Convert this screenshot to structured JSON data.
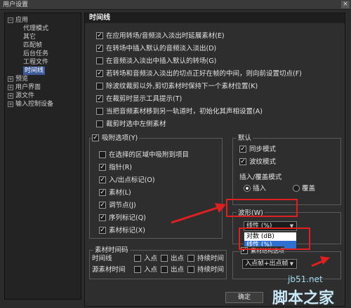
{
  "window": {
    "title": "用户设置",
    "close_glyph": "×"
  },
  "tree": {
    "items": [
      {
        "label": "应用",
        "expander": "−"
      },
      {
        "label": "代理模式"
      },
      {
        "label": "其它"
      },
      {
        "label": "匹配帧"
      },
      {
        "label": "后台任务"
      },
      {
        "label": "工程文件"
      },
      {
        "label": "时间线"
      },
      {
        "label": "预览",
        "expander": "+"
      },
      {
        "label": "用户界面",
        "expander": "+"
      },
      {
        "label": "源文件",
        "expander": "+"
      },
      {
        "label": "输入控制设备",
        "expander": "+"
      }
    ]
  },
  "panel": {
    "title": "时间线",
    "options": [
      {
        "label": "在应用转场/音频淡入淡出时延展素材(E)",
        "checked": true
      },
      {
        "label": "在转场中插入默认的音频淡入淡出(D)",
        "checked": true
      },
      {
        "label": "在音频淡入淡出中插入默认的转场(G)",
        "checked": false
      },
      {
        "label": "若转场和音频淡入淡出的切点正好在帧的中间，则向前设置切点(F)",
        "checked": true
      },
      {
        "label": "除波纹裁剪以外,剪切素材时保持下一个素材位置(K)",
        "checked": false
      },
      {
        "label": "在裁剪时显示工具提示(T)",
        "checked": true
      },
      {
        "label": "当把音频素材移到另一轨道时，初始化其声相设置(A)",
        "checked": false
      },
      {
        "label": "裁剪时选中左侧素材",
        "checked": false
      }
    ],
    "snap": {
      "title": "吸附选项(Y)",
      "checked": true,
      "items": [
        {
          "label": "在选择的区域中吸附到项目",
          "checked": false
        },
        {
          "label": "指针(R)",
          "checked": true
        },
        {
          "label": "入/出点标记(O)",
          "checked": true
        },
        {
          "label": "素材(L)",
          "checked": true
        },
        {
          "label": "调节点(J)",
          "checked": true
        },
        {
          "label": "序列标记(Q)",
          "checked": true
        },
        {
          "label": "素材标记(X)",
          "checked": true
        }
      ]
    },
    "defaults": {
      "title": "默认",
      "sync_mode": {
        "label": "同步模式",
        "checked": true
      },
      "ripple_mode": {
        "label": "波纹模式",
        "checked": true
      },
      "insert_mode_label": "插入/覆盖模式",
      "insert_radio": {
        "label": "插入",
        "selected": true
      },
      "overwrite_radio": {
        "label": "覆盖",
        "selected": false
      }
    },
    "waveform": {
      "label": "波形(W)",
      "selected": "线性 (%)",
      "options": [
        "对数 (dB)",
        "线性 (%)"
      ],
      "highlighted_index": 1
    },
    "timecode": {
      "title": "素材时间码",
      "timeline_label": "时间线",
      "source_label": "源素材时间",
      "in_point": "入点",
      "out_point": "出点",
      "duration": "持续时间"
    },
    "hidden_item_label": "素材结构选项",
    "bottom_select": "入点帧+出点帧"
  },
  "buttons": {
    "ok": "确定"
  },
  "watermark": {
    "site": "jb51.net",
    "brand": "脚本之家"
  },
  "colors": {
    "annotation_red": "#e02020",
    "selection_blue": "#3d5a9a",
    "highlight_blue": "#3070d0"
  }
}
